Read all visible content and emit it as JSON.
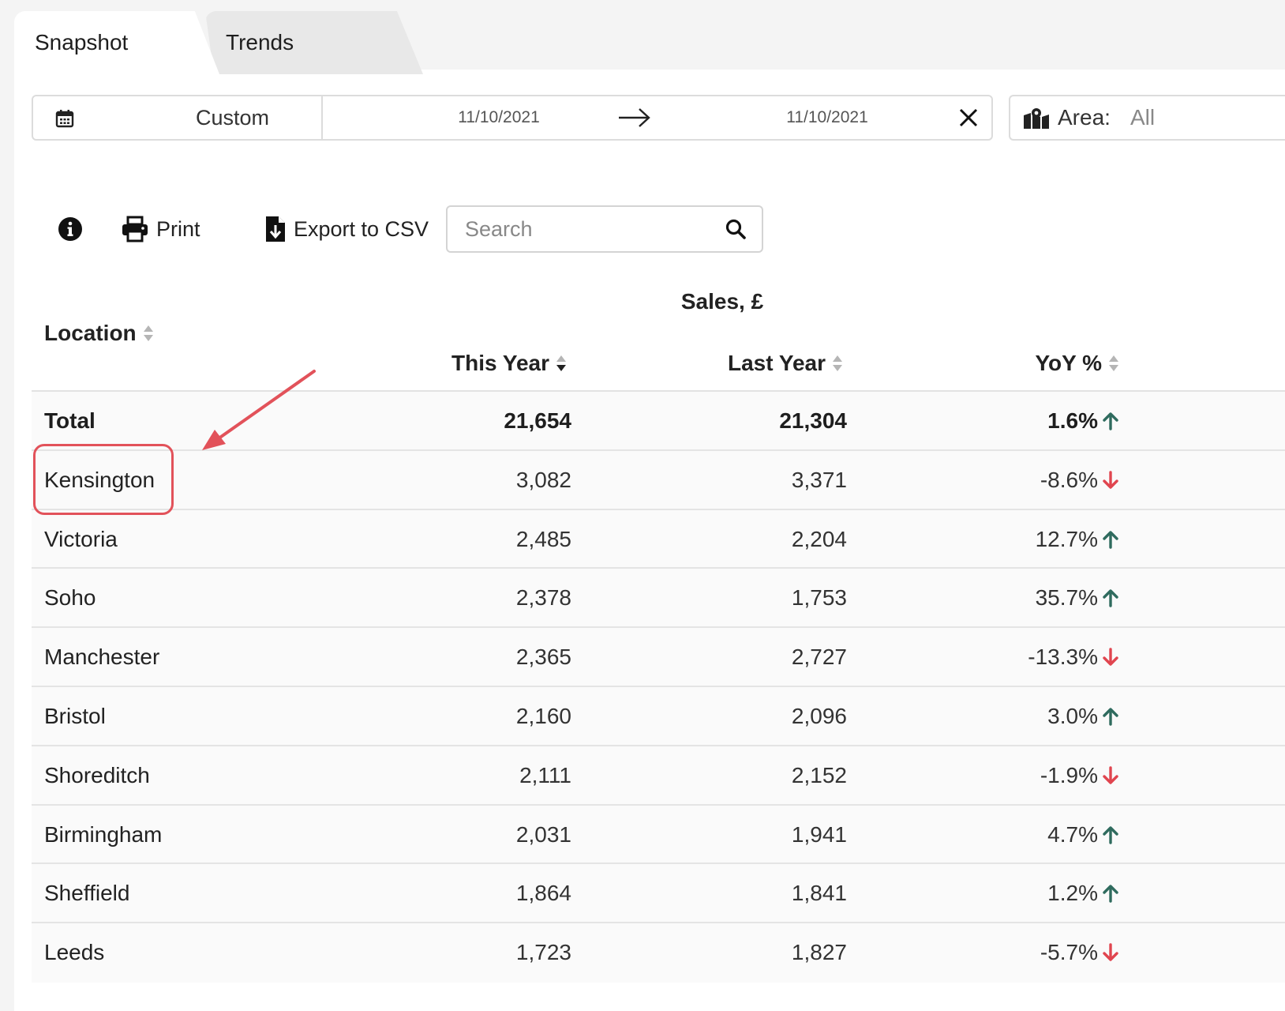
{
  "tabs": [
    {
      "label": "Snapshot",
      "active": true
    },
    {
      "label": "Trends",
      "active": false
    }
  ],
  "date_range": {
    "preset": "Custom",
    "start": "11/10/2021",
    "end": "11/10/2021"
  },
  "area": {
    "label": "Area:",
    "value": "All"
  },
  "toolbar": {
    "print_label": "Print",
    "export_label": "Export to CSV",
    "search_placeholder": "Search"
  },
  "table": {
    "group_header": "Sales, £",
    "columns": {
      "location": "Location",
      "this_year": "This Year",
      "last_year": "Last Year",
      "yoy": "YoY %"
    },
    "rows": [
      {
        "location": "Total",
        "this_year": "21,654",
        "last_year": "21,304",
        "yoy": "1.6%",
        "trend": "up"
      },
      {
        "location": "Kensington",
        "this_year": "3,082",
        "last_year": "3,371",
        "yoy": "-8.6%",
        "trend": "down"
      },
      {
        "location": "Victoria",
        "this_year": "2,485",
        "last_year": "2,204",
        "yoy": "12.7%",
        "trend": "up"
      },
      {
        "location": "Soho",
        "this_year": "2,378",
        "last_year": "1,753",
        "yoy": "35.7%",
        "trend": "up"
      },
      {
        "location": "Manchester",
        "this_year": "2,365",
        "last_year": "2,727",
        "yoy": "-13.3%",
        "trend": "down"
      },
      {
        "location": "Bristol",
        "this_year": "2,160",
        "last_year": "2,096",
        "yoy": "3.0%",
        "trend": "up"
      },
      {
        "location": "Shoreditch",
        "this_year": "2,111",
        "last_year": "2,152",
        "yoy": "-1.9%",
        "trend": "down"
      },
      {
        "location": "Birmingham",
        "this_year": "2,031",
        "last_year": "1,941",
        "yoy": "4.7%",
        "trend": "up"
      },
      {
        "location": "Sheffield",
        "this_year": "1,864",
        "last_year": "1,841",
        "yoy": "1.2%",
        "trend": "up"
      },
      {
        "location": "Leeds",
        "this_year": "1,723",
        "last_year": "1,827",
        "yoy": "-5.7%",
        "trend": "down"
      }
    ]
  },
  "colors": {
    "trend_up": "#2f6b5e",
    "trend_down": "#e0454f",
    "annotation": "#e2525a"
  }
}
